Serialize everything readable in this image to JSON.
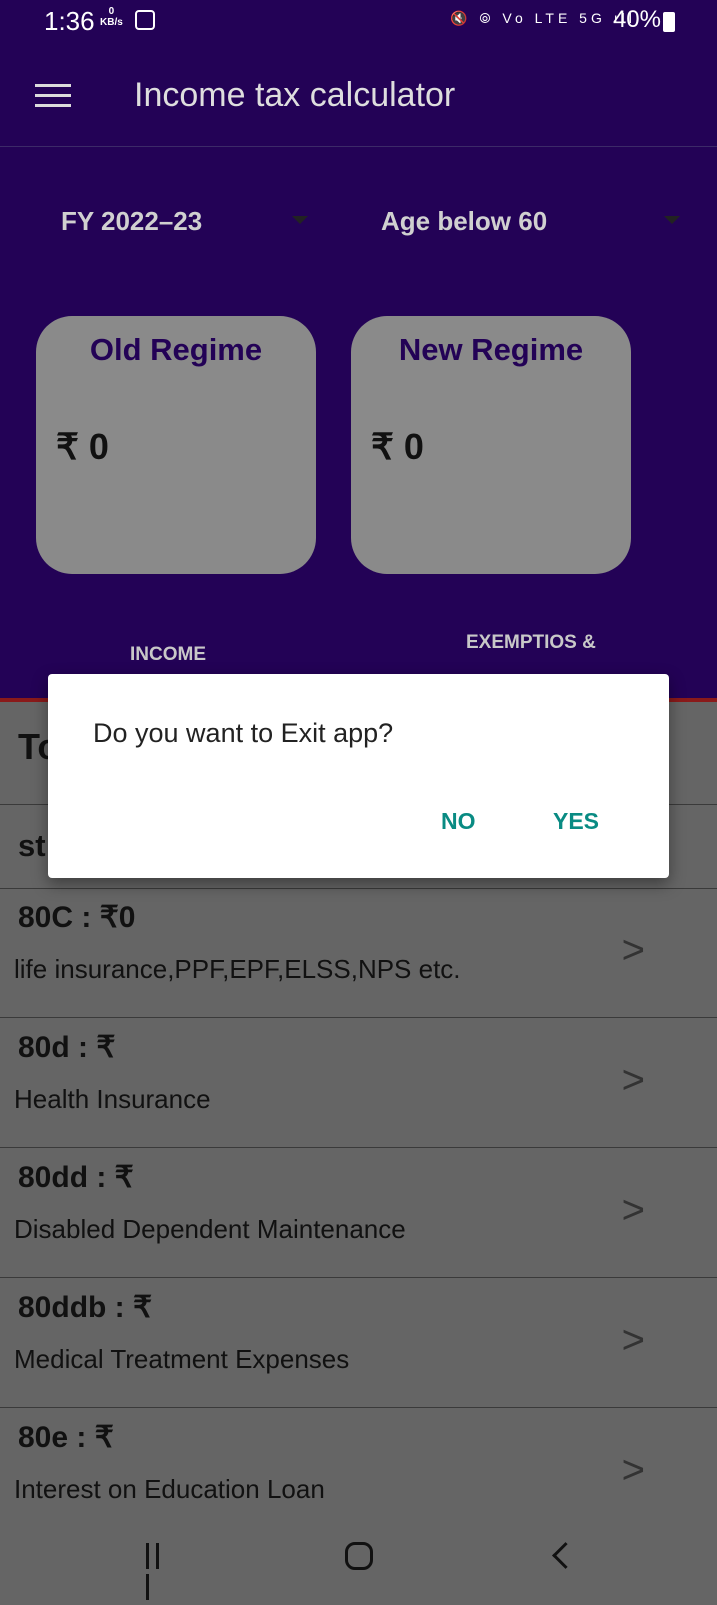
{
  "status_bar": {
    "time": "1:36",
    "net_speed_value": "0",
    "net_speed_unit": "KB/s",
    "icons_label": "🔇 ⦾ Vo LTE 5G ıll",
    "battery": "40%"
  },
  "app_bar": {
    "title": "Income tax calculator"
  },
  "selectors": {
    "fy": "FY 2022–23",
    "age": "Age below 60"
  },
  "cards": {
    "old": {
      "title": "Old Regime",
      "value": "₹ 0"
    },
    "new": {
      "title": "New Regime",
      "value": "₹ 0"
    }
  },
  "tabs": {
    "income": "INCOME",
    "exemptions": "EXEMPTIOS &"
  },
  "partial_rows": {
    "first": "To",
    "second": "st"
  },
  "rows": [
    {
      "title": "80C : ₹0",
      "subtitle": "life insurance,PPF,EPF,ELSS,NPS etc.",
      "chevron": ">"
    },
    {
      "title": "80d : ₹",
      "subtitle": "Health Insurance",
      "chevron": ">"
    },
    {
      "title": "80dd : ₹",
      "subtitle": "Disabled Dependent Maintenance",
      "chevron": ">"
    },
    {
      "title": "80ddb : ₹",
      "subtitle": "Medical Treatment Expenses",
      "chevron": ">"
    },
    {
      "title": "80e : ₹",
      "subtitle": "Interest on Education Loan",
      "chevron": ">"
    }
  ],
  "dialog": {
    "message": "Do you want to Exit app?",
    "no": "NO",
    "yes": "YES"
  },
  "colors": {
    "header": "#230256",
    "accent": "#098b83",
    "overlay": "#656565"
  }
}
